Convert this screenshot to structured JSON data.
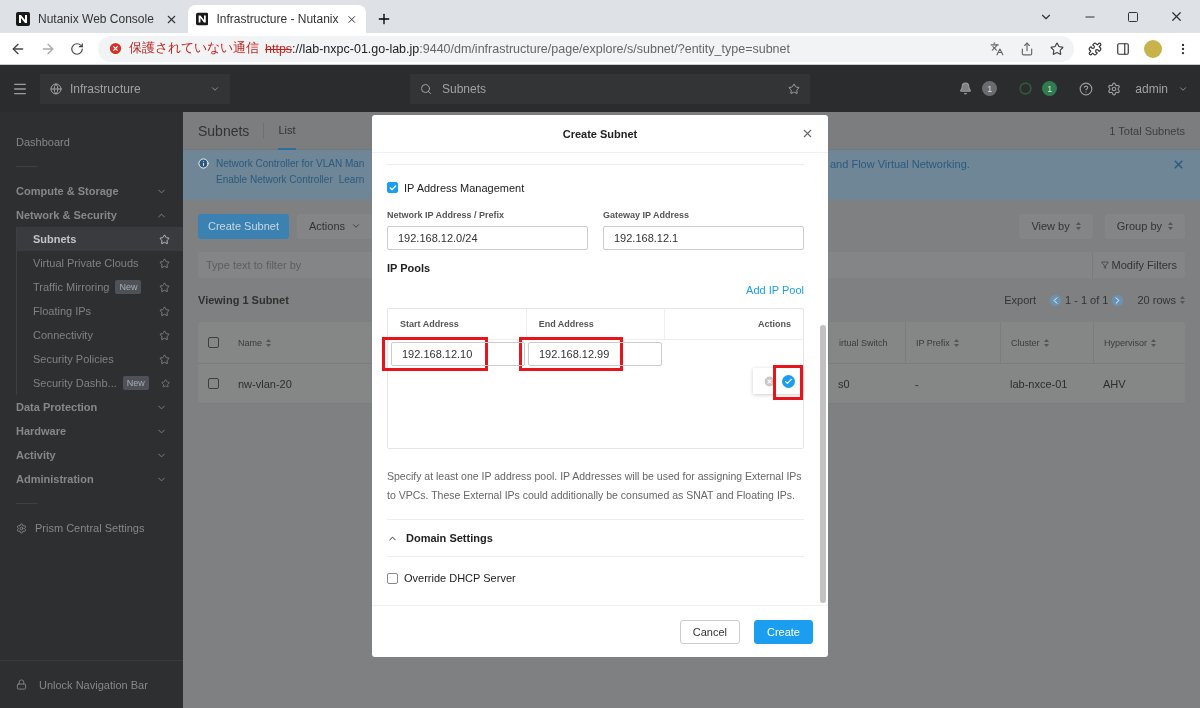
{
  "browser": {
    "tabs": [
      {
        "title": "Nutanix Web Console",
        "selected": false
      },
      {
        "title": "Infrastructure - Nutanix",
        "selected": true
      }
    ],
    "security_label": "保護されていない通信",
    "url": {
      "scheme": "https",
      "host": "://lab-nxpc-01.go-lab.jp",
      "path": ":9440/dm/infrastructure/page/explore/s/subnet/?entity_type=subnet"
    }
  },
  "top_nav": {
    "app": "Infrastructure",
    "search": "Subnets",
    "alerts_count": "1",
    "tasks_count": "1",
    "user": "admin"
  },
  "sidebar": {
    "dashboard": "Dashboard",
    "groups": [
      {
        "label": "Compute & Storage",
        "expanded": false
      },
      {
        "label": "Network & Security",
        "expanded": true,
        "children": [
          {
            "label": "Subnets",
            "selected": true
          },
          {
            "label": "Virtual Private Clouds",
            "selected": false
          },
          {
            "label": "Traffic Mirroring",
            "selected": false,
            "badge": "New"
          },
          {
            "label": "Floating IPs",
            "selected": false
          },
          {
            "label": "Connectivity",
            "selected": false
          },
          {
            "label": "Security Policies",
            "selected": false
          },
          {
            "label": "Security Dashb...",
            "selected": false,
            "badge": "New"
          }
        ]
      },
      {
        "label": "Data Protection",
        "expanded": false
      },
      {
        "label": "Hardware",
        "expanded": false
      },
      {
        "label": "Activity",
        "expanded": false
      },
      {
        "label": "Administration",
        "expanded": false
      }
    ],
    "settings": "Prism Central Settings",
    "unlock": "Unlock Navigation Bar"
  },
  "page": {
    "title": "Subnets",
    "tabs": [
      {
        "label": "List",
        "selected": true
      }
    ],
    "total": "1 Total Subnets",
    "banner": {
      "line1": "Network Controller for VLAN Man",
      "link1": "Enable Network Controller",
      "link2": "Learn",
      "line1_end": "and Flow Virtual Networking."
    },
    "create_button": "Create Subnet",
    "actions_button": "Actions",
    "view_by": "View by",
    "group_by": "Group by",
    "filter_placeholder": "Type text to filter by",
    "modify_filters": "Modify Filters",
    "viewing": "Viewing 1 Subnet",
    "export": "Export",
    "pagination": "1 - 1 of 1",
    "rows_per_page": "20 rows",
    "table": {
      "select_all_checked": false,
      "columns": [
        "Name",
        "irtual Switch",
        "IP Prefix",
        "Cluster",
        "Hypervisor"
      ],
      "rows": [
        {
          "checked": false,
          "cells": [
            "nw-vlan-20",
            "s0",
            "-",
            "lab-nxce-01",
            "AHV"
          ]
        }
      ]
    }
  },
  "modal": {
    "title": "Create Subnet",
    "ipam": {
      "label": "IP Address Management",
      "checked": true
    },
    "network_label": "Network IP Address / Prefix",
    "network_value": "192.168.12.0/24",
    "gateway_label": "Gateway IP Address",
    "gateway_value": "192.168.12.1",
    "pools_title": "IP Pools",
    "add_pool": "Add IP Pool",
    "pool_columns": [
      "Start Address",
      "End Address",
      "Actions"
    ],
    "pool_row": {
      "start": "192.168.12.10",
      "end": "192.168.12.99",
      "start_highlighted": true,
      "end_highlighted": true,
      "confirm_highlighted": true
    },
    "help": "Specify at least one IP address pool. IP Addresses will be used for assigning External IPs to VPCs. These External IPs could additionally be consumed as SNAT and Floating IPs.",
    "domain_settings": {
      "label": "Domain Settings",
      "expanded": true
    },
    "override_dhcp": {
      "label": "Override DHCP Server",
      "checked": false
    },
    "buttons": [
      "Cancel",
      "Create"
    ]
  }
}
